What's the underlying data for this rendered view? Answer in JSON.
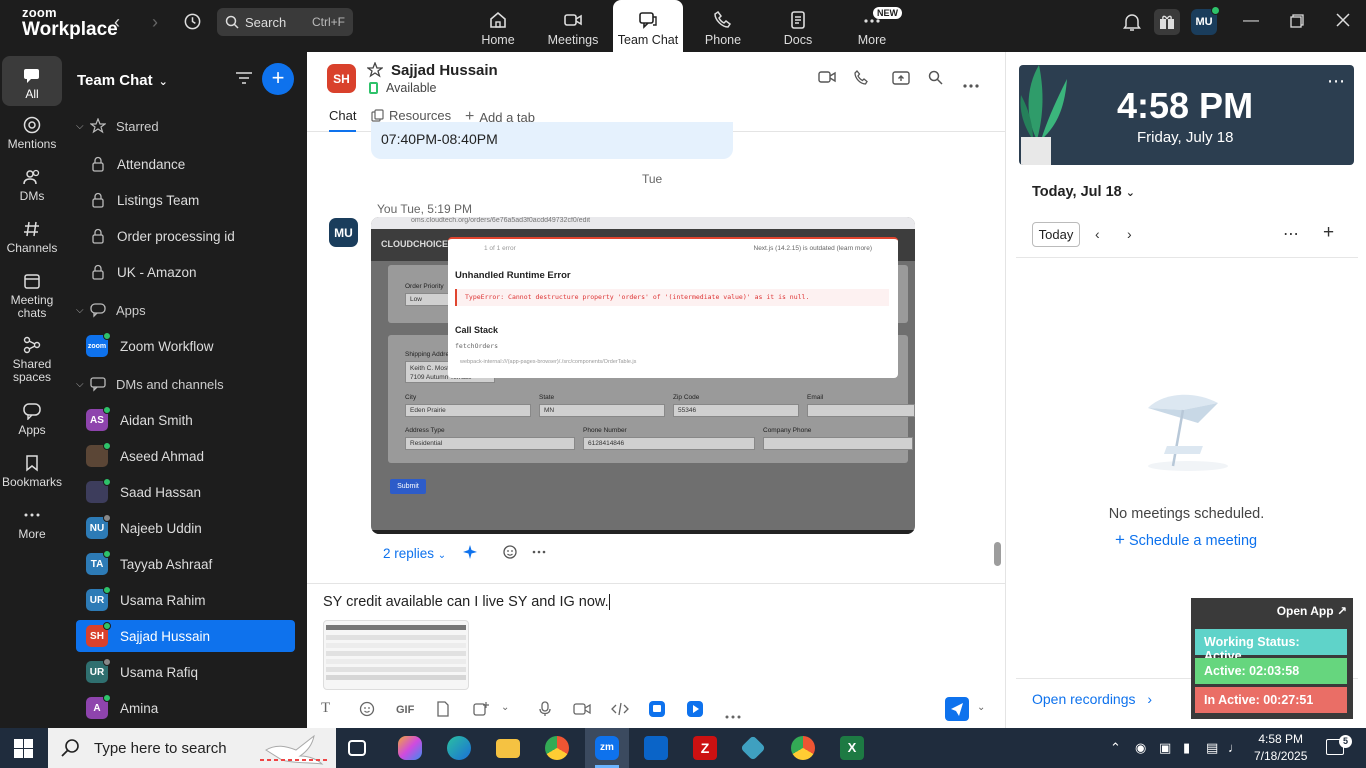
{
  "app": {
    "logo_line1": "zoom",
    "logo_line2": "Workplace",
    "search_label": "Search",
    "search_shortcut": "Ctrl+F",
    "tabs": [
      {
        "label": "Home",
        "icon": "home-icon"
      },
      {
        "label": "Meetings",
        "icon": "video-icon"
      },
      {
        "label": "Team Chat",
        "icon": "chat-icon"
      },
      {
        "label": "Phone",
        "icon": "phone-icon"
      },
      {
        "label": "Docs",
        "icon": "docs-icon"
      },
      {
        "label": "More",
        "icon": "more-icon"
      }
    ],
    "new_badge": "NEW",
    "user_initials": "MU"
  },
  "rail": {
    "items": [
      {
        "label": "All",
        "icon": "chat-icon"
      },
      {
        "label": "Mentions",
        "icon": "at-icon"
      },
      {
        "label": "DMs",
        "icon": "people-icon"
      },
      {
        "label": "Channels",
        "icon": "hash-icon"
      },
      {
        "label": "Meeting chats",
        "icon": "calendar-icon"
      },
      {
        "label": "Shared spaces",
        "icon": "share-icon"
      },
      {
        "label": "Apps",
        "icon": "apps-icon"
      },
      {
        "label": "Bookmarks",
        "icon": "bookmark-icon"
      },
      {
        "label": "More",
        "icon": "more-icon"
      }
    ]
  },
  "list": {
    "title": "Team Chat",
    "starred_label": "Starred",
    "starred": [
      "Attendance",
      "Listings Team",
      "Order processing id",
      "UK - Amazon"
    ],
    "apps_label": "Apps",
    "apps": [
      {
        "name": "Zoom Workflow",
        "badge": "zoom"
      }
    ],
    "dms_label": "DMs and channels",
    "dms": [
      {
        "name": "Aidan Smith",
        "initials": "AS",
        "color": "#8e44ad",
        "status": "#2ec26a"
      },
      {
        "name": "Aseed Ahmad",
        "initials": "",
        "color": "#5b4636",
        "status": "#2ec26a"
      },
      {
        "name": "Saad Hassan",
        "initials": "",
        "color": "#3d3d5c",
        "status": "#2ec26a"
      },
      {
        "name": "Najeeb Uddin",
        "initials": "NU",
        "color": "#2d7bb6",
        "status": "#888888"
      },
      {
        "name": "Tayyab Ashraaf",
        "initials": "TA",
        "color": "#2d7bb6",
        "status": "#2ec26a"
      },
      {
        "name": "Usama Rahim",
        "initials": "UR",
        "color": "#2d7bb6",
        "status": "#2ec26a"
      },
      {
        "name": "Sajjad Hussain",
        "initials": "SH",
        "color": "#d9412c",
        "status": "#2ec26a"
      },
      {
        "name": "Usama Rafiq",
        "initials": "UR",
        "color": "#2f6f6f",
        "status": "#888888"
      },
      {
        "name": "Amina",
        "initials": "A",
        "color": "#8e44ad",
        "status": "#2ec26a"
      }
    ]
  },
  "chat": {
    "contact_initials": "SH",
    "contact_name": "Sajjad Hussain",
    "contact_status": "Available",
    "subtabs": [
      "Chat",
      "Resources",
      "Add a tab"
    ],
    "previous_bubble": "07:40PM-08:40PM",
    "day_label": "Tue",
    "sender_initials": "MU",
    "message_meta": "You Tue, 5:19 PM",
    "screenshot": {
      "url": "oms.cloudtech.org/orders/6e76a5ad3f0acdd49732cf0/edit",
      "brand": "CLOUDCHOICE",
      "error_counter": "1 of 1 error",
      "error_title": "Unhandled Runtime Error",
      "error_message": "TypeError: Cannot destructure property 'orders' of '(intermediate value)' as it is null.",
      "next_info": "Next.js (14.2.15) is outdated (learn more)",
      "call_stack": "Call Stack",
      "stack_fn": "fetchOrders",
      "stack_path": "webpack-internal:///(app-pages-browser)/./src/components/OrderTable.js",
      "order_priority_label": "Order Priority",
      "order_priority_value": "Low",
      "shipping_label": "Shipping Address",
      "shipping_line1": "Keith C. Most",
      "shipping_line2": "7109 Autumn Terrace",
      "city_label": "City",
      "city_value": "Eden Prairie",
      "state_label": "State",
      "state_value": "MN",
      "zip_label": "Zip Code",
      "zip_value": "55346",
      "email_label": "Email",
      "address_type_label": "Address Type",
      "address_type_value": "Residential",
      "phone_label": "Phone Number",
      "phone_value": "6128414846",
      "company_phone_label": "Company Phone",
      "submit_label": "Submit"
    },
    "replies": "2 replies",
    "compose_text": "SY credit available can I live SY and IG now."
  },
  "calendar": {
    "time": "4:58 PM",
    "date": "Friday, July 18",
    "header": "Today, Jul 18",
    "today_btn": "Today",
    "empty_text": "No meetings scheduled.",
    "schedule_link": "Schedule a meeting",
    "recordings_link": "Open recordings"
  },
  "widget": {
    "open_app": "Open App",
    "working_status": "Working Status: Active",
    "active": "Active: 02:03:58",
    "inactive": "In Active: 00:27:51",
    "colors": {
      "working": "#5fd3c9",
      "active": "#66d67e",
      "inactive": "#ea6e66"
    }
  },
  "taskbar": {
    "search_placeholder": "Type here to search",
    "time": "4:58 PM",
    "date": "7/18/2025",
    "notification_count": "5"
  }
}
